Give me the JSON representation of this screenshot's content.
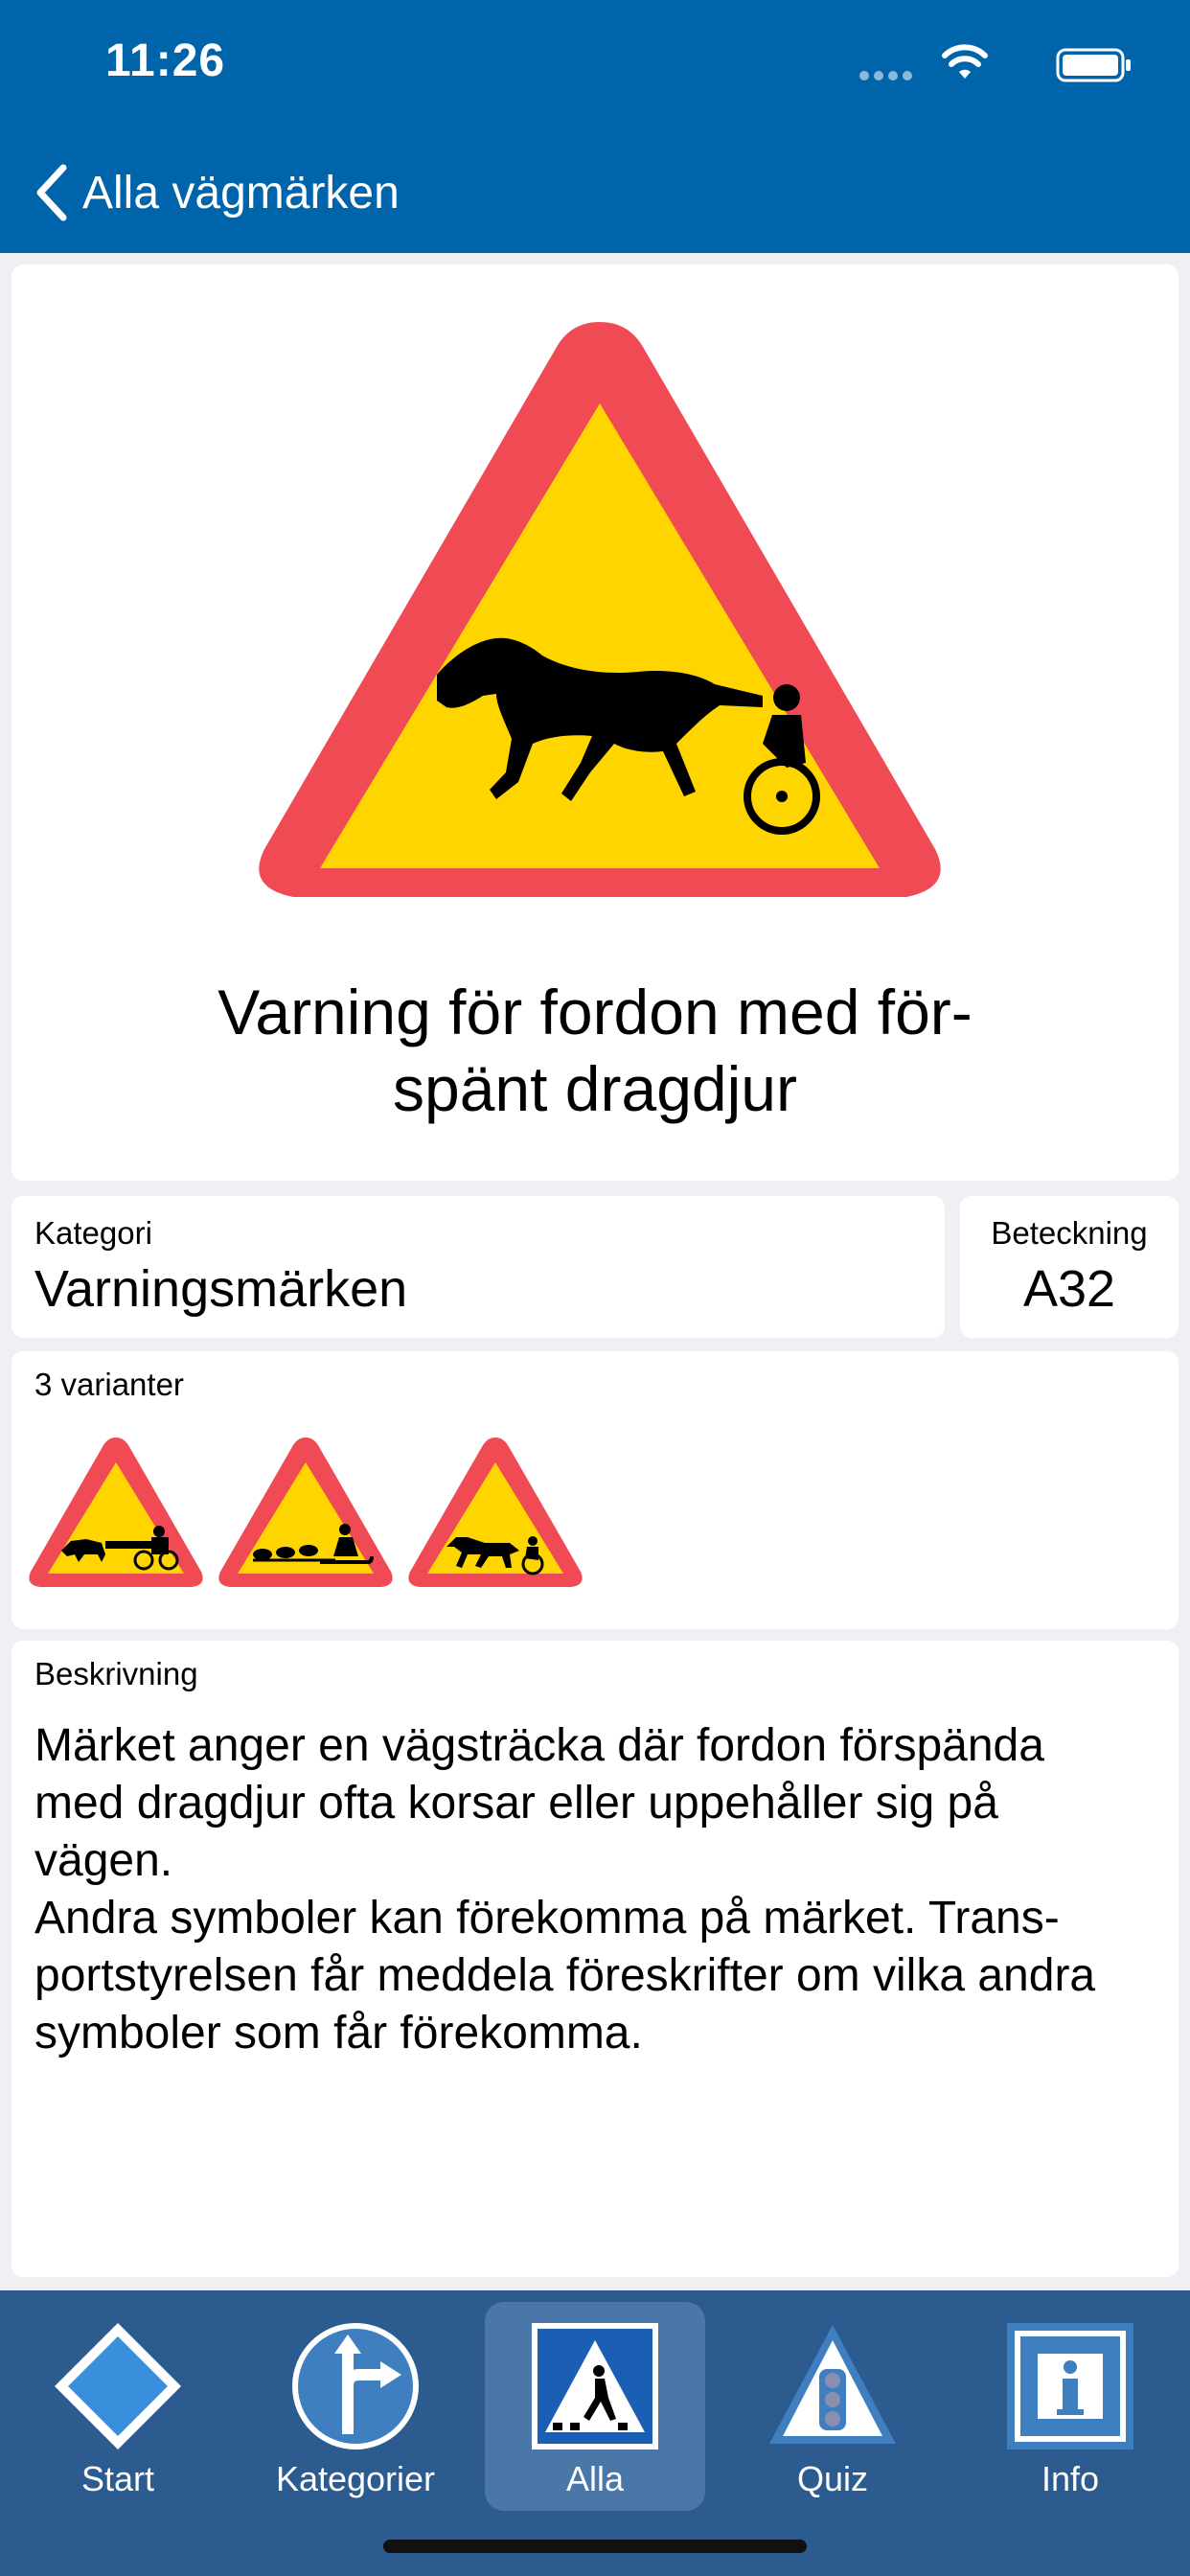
{
  "status": {
    "time": "11:26"
  },
  "nav": {
    "back_label": "Alla vägmärken"
  },
  "sign": {
    "title": "Varning för fordon med för-\nspänt dragdjur",
    "colors": {
      "border": "#f04b55",
      "fill": "#ffd500",
      "symbol": "#000000"
    }
  },
  "category": {
    "label": "Kategori",
    "value": "Varningsmärken"
  },
  "designation": {
    "label": "Beteckning",
    "value": "A32"
  },
  "variants": {
    "label": "3 varianter",
    "items": [
      "horse-carriage-sign-icon",
      "dog-sled-sign-icon",
      "trotting-horse-sign-icon"
    ]
  },
  "description": {
    "label": "Beskrivning",
    "text": "Märket anger en vägsträcka där fordon förspända med dragdjur ofta korsar eller uppehåller sig på vägen.\nAndra symboler kan förekomma på märket. Trans-portstyrelsen får meddela föreskrifter om vilka andra symboler som får förekomma."
  },
  "tabs": [
    {
      "label": "Start",
      "icon": "diamond-sign-icon"
    },
    {
      "label": "Kategorier",
      "icon": "direction-sign-icon"
    },
    {
      "label": "Alla",
      "icon": "pedestrian-crossing-icon",
      "active": true
    },
    {
      "label": "Quiz",
      "icon": "traffic-light-sign-icon"
    },
    {
      "label": "Info",
      "icon": "info-sign-icon"
    }
  ],
  "theme": {
    "header_bg": "#0064ab",
    "tabbar_bg": "#2c5b8f",
    "tab_active_bg": "#4a76a8"
  }
}
